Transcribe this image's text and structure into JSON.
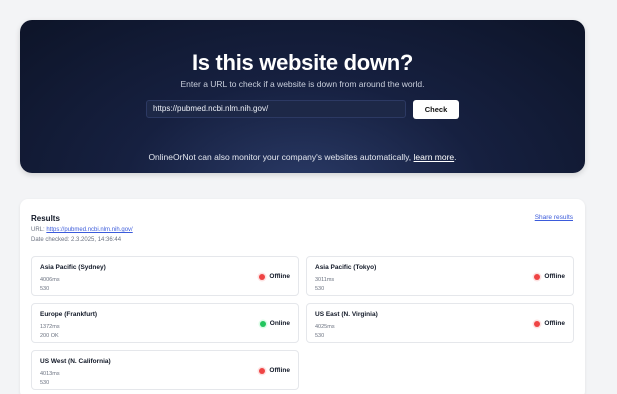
{
  "hero": {
    "title": "Is this website down?",
    "subtitle": "Enter a URL to check if a website is down from around the world.",
    "url_value": "https://pubmed.ncbi.nlm.nih.gov/",
    "check_label": "Check",
    "note_prefix": "OnlineOrNot can also monitor your company's websites automatically,",
    "note_link": "learn more",
    "note_suffix": "."
  },
  "results": {
    "title": "Results",
    "share_label": "Share results",
    "url_label": "URL:",
    "url_value": "https://pubmed.ncbi.nlm.nih.gov/",
    "date_label": "Date checked:",
    "date_value": "2.3.2025, 14:36:44",
    "cards": [
      {
        "region": "Asia Pacific (Sydney)",
        "time": "4006ms",
        "code": "530",
        "status": "Offline",
        "state": "offline"
      },
      {
        "region": "Asia Pacific (Tokyo)",
        "time": "3011ms",
        "code": "530",
        "status": "Offline",
        "state": "offline"
      },
      {
        "region": "Europe (Frankfurt)",
        "time": "1372ms",
        "code": "200 OK",
        "status": "Online",
        "state": "online"
      },
      {
        "region": "US East (N. Virginia)",
        "time": "4025ms",
        "code": "530",
        "status": "Offline",
        "state": "offline"
      },
      {
        "region": "US West (N. California)",
        "time": "4013ms",
        "code": "530",
        "status": "Offline",
        "state": "offline"
      }
    ]
  },
  "colors": {
    "hero_bg": "#0d1428",
    "offline": "#ef4444",
    "online": "#22c55e",
    "link": "#3b5bdb"
  }
}
